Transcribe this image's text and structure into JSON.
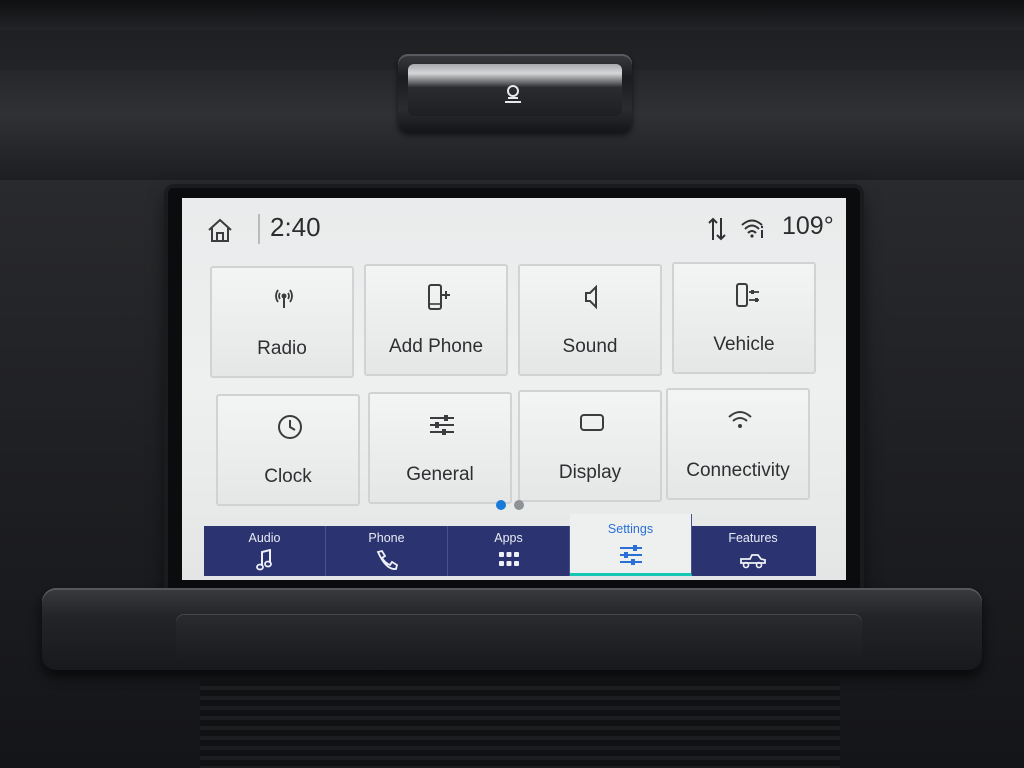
{
  "status": {
    "time": "2:40",
    "temperature": "109°"
  },
  "tiles": [
    {
      "label": "Radio",
      "icon": "radio-antenna-icon"
    },
    {
      "label": "Add Phone",
      "icon": "add-phone-icon"
    },
    {
      "label": "Sound",
      "icon": "speaker-icon"
    },
    {
      "label": "Vehicle",
      "icon": "vehicle-settings-icon"
    },
    {
      "label": "Clock",
      "icon": "clock-icon"
    },
    {
      "label": "General",
      "icon": "sliders-icon"
    },
    {
      "label": "Display",
      "icon": "display-icon"
    },
    {
      "label": "Connectivity",
      "icon": "wifi-icon"
    }
  ],
  "pager": {
    "total": 2,
    "active": 1
  },
  "nav": [
    {
      "label": "Audio",
      "icon": "music-note-icon"
    },
    {
      "label": "Phone",
      "icon": "phone-handset-icon"
    },
    {
      "label": "Apps",
      "icon": "apps-grid-icon"
    },
    {
      "label": "Settings",
      "icon": "settings-sliders-icon",
      "active": true
    },
    {
      "label": "Features",
      "icon": "truck-icon"
    }
  ],
  "colors": {
    "nav_background": "#2b3470",
    "active_accent": "#2a6fd6",
    "active_underline": "#18c6b6",
    "page_dot_active": "#1a7ad9"
  }
}
